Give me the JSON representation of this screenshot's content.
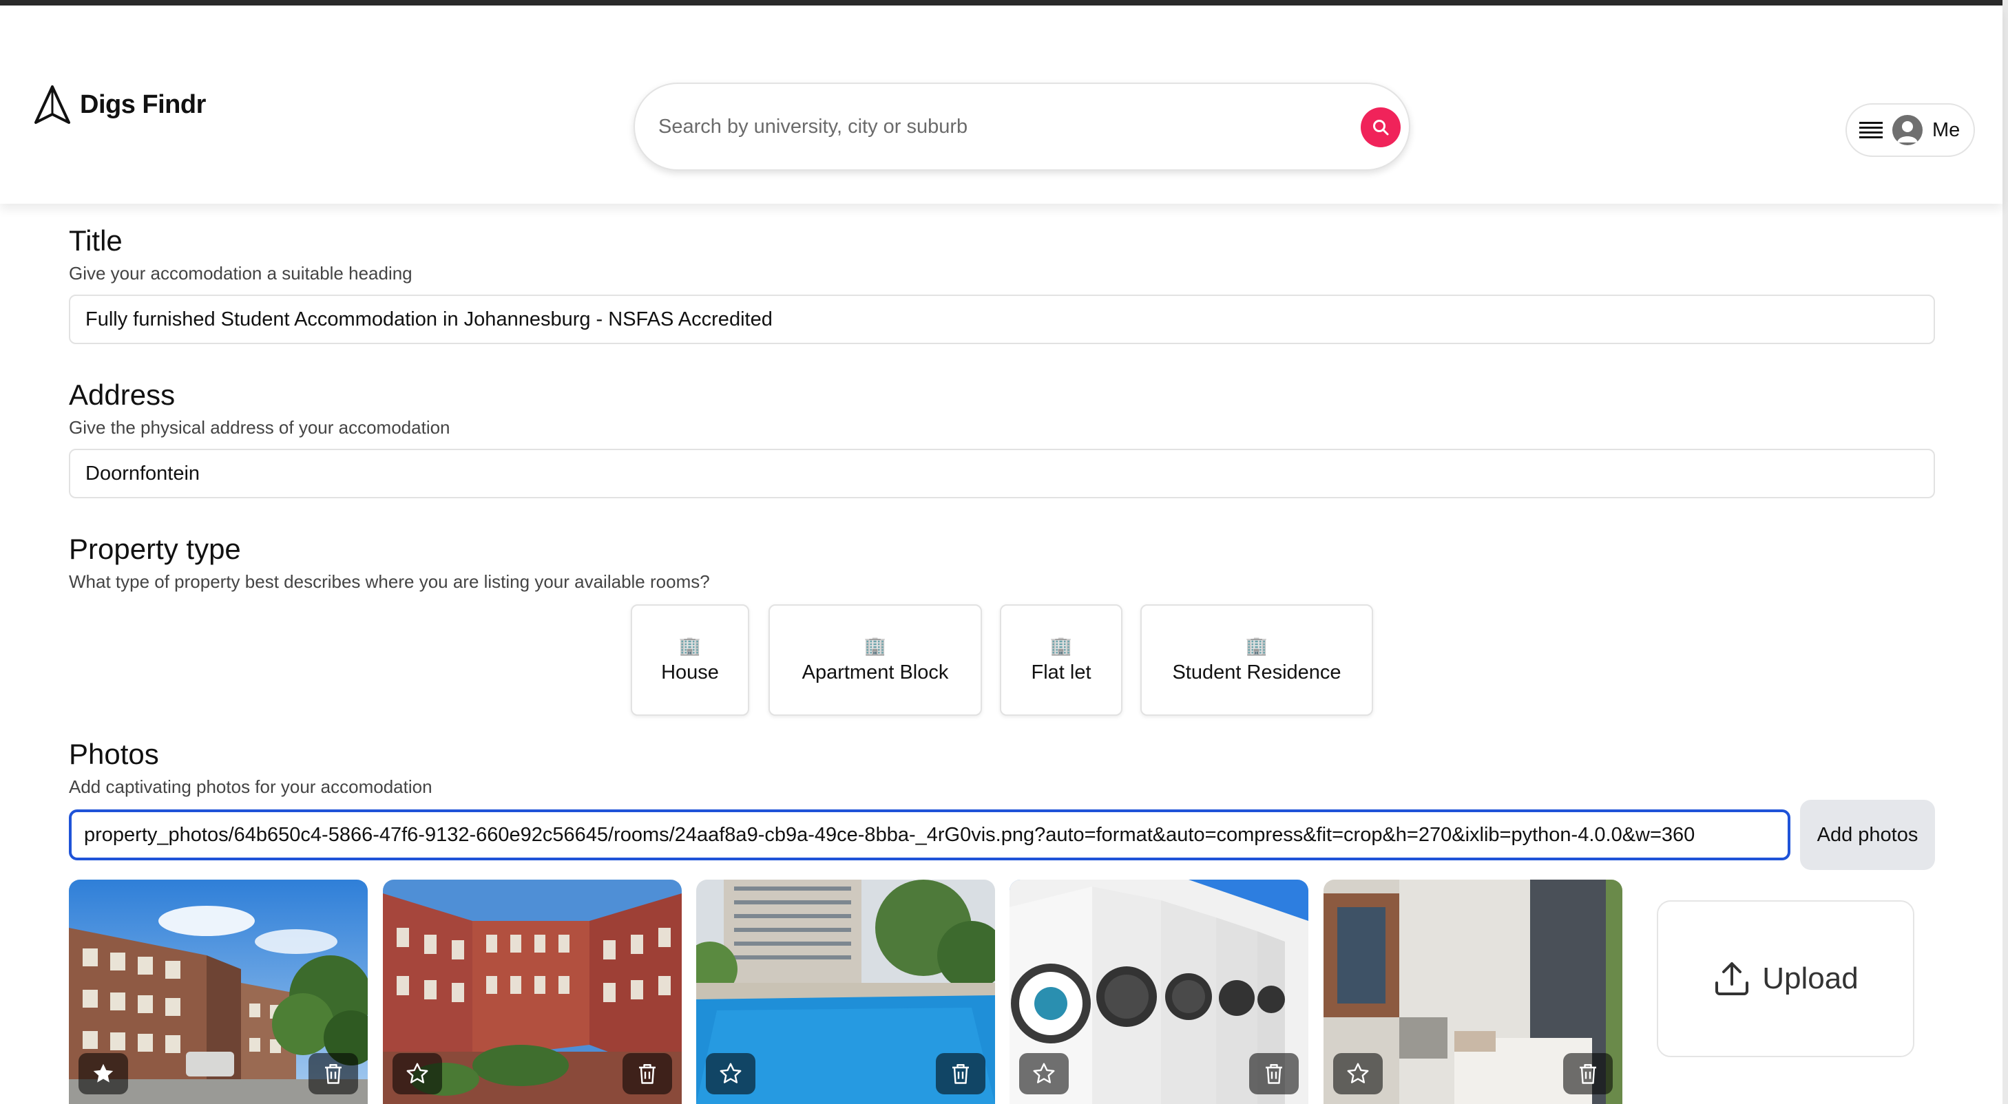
{
  "header": {
    "app_name": "Digs Findr",
    "logo_icon": "navigation-arrow-icon",
    "search_placeholder": "Search by university, city or suburb",
    "search_button_icon": "search-icon",
    "user_menu_label": "Me"
  },
  "title_section": {
    "heading": "Title",
    "subtitle": "Give your accomodation a suitable heading",
    "value": "Fully furnished Student Accommodation in Johannesburg - NSFAS Accredited"
  },
  "address_section": {
    "heading": "Address",
    "subtitle": "Give the physical address of your accomodation",
    "value": "Doornfontein"
  },
  "property_type_section": {
    "heading": "Property type",
    "subtitle": "What type of property best describes where you are listing your available rooms?",
    "options": [
      {
        "label": "House",
        "icon": "building-icon"
      },
      {
        "label": "Apartment Block",
        "icon": "building-icon"
      },
      {
        "label": "Flat let",
        "icon": "building-icon"
      },
      {
        "label": "Student Residence",
        "icon": "building-icon"
      }
    ]
  },
  "photos_section": {
    "heading": "Photos",
    "subtitle": "Add captivating photos for your accomodation",
    "url_value": "property_photos/64b650c4-5866-47f6-9132-660e92c56645/rooms/24aaf8a9-cb9a-49ce-8bba-_4rG0vis.png?auto=format&auto=compress&fit=crop&h=270&ixlib=python-4.0.0&w=360",
    "add_button": "Add photos",
    "upload_label": "Upload",
    "photos": [
      {
        "subject": "brick residence building",
        "starred": true
      },
      {
        "subject": "brick courtyard",
        "starred": false
      },
      {
        "subject": "swimming pool",
        "starred": false
      },
      {
        "subject": "laundry washing machines",
        "starred": false
      },
      {
        "subject": "bedroom interior",
        "starred": false
      }
    ]
  },
  "colors": {
    "accent": "#f0235a",
    "focus_border": "#1f53d8"
  }
}
